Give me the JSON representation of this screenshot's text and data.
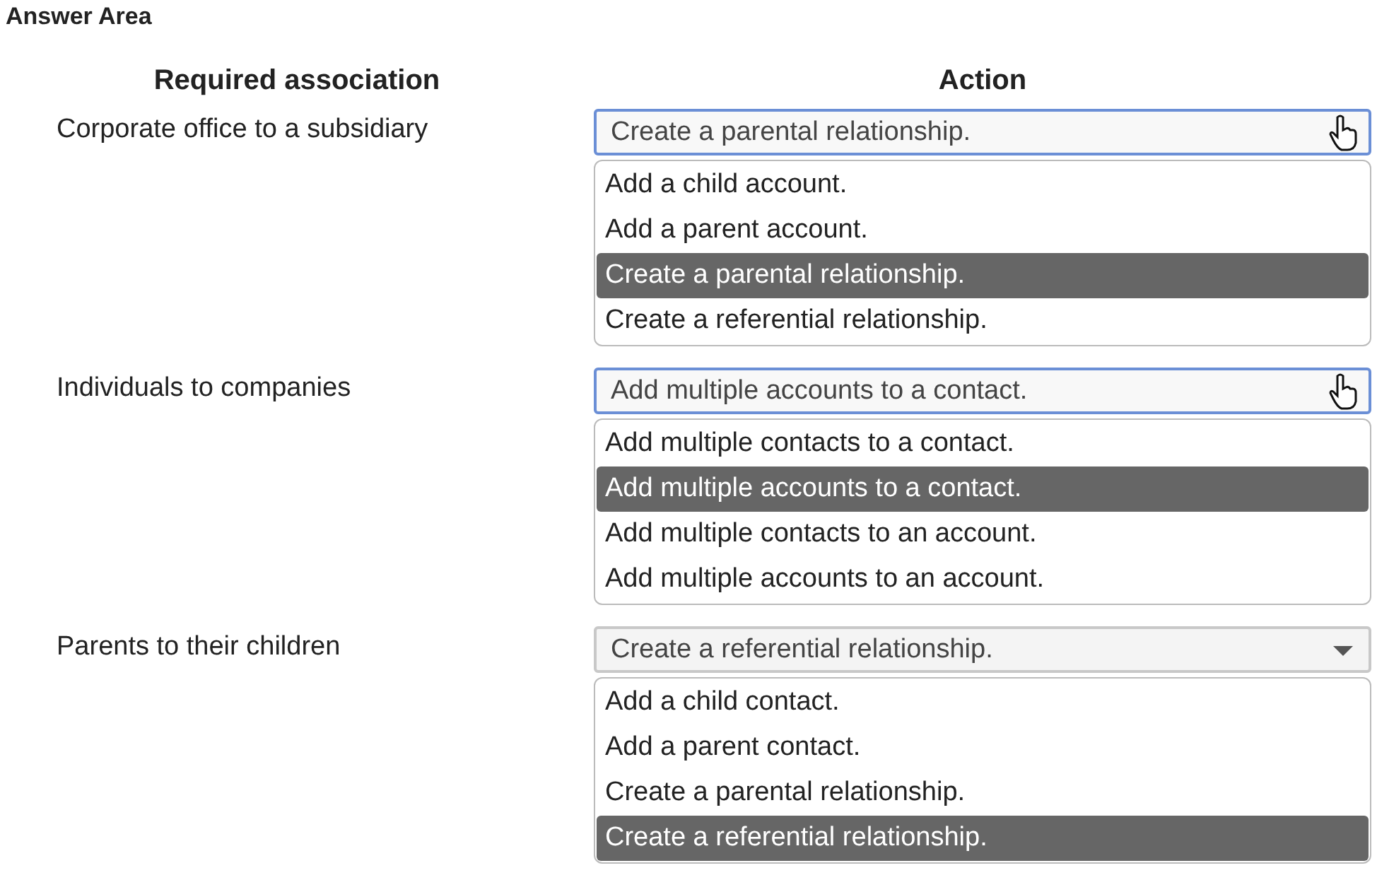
{
  "title": "Answer Area",
  "headers": [
    "Required association",
    "Action"
  ],
  "rows": [
    {
      "association": "Corporate office to a subsidiary",
      "dropdown": {
        "value": "Create a parental relationship.",
        "focused": true,
        "options": [
          {
            "label": "Add a child account.",
            "selected": false
          },
          {
            "label": "Add a parent account.",
            "selected": false
          },
          {
            "label": "Create a parental relationship.",
            "selected": true
          },
          {
            "label": "Create a referential relationship.",
            "selected": false
          }
        ]
      }
    },
    {
      "association": "Individuals to companies",
      "dropdown": {
        "value": "Add multiple accounts to a contact.",
        "focused": true,
        "options": [
          {
            "label": "Add multiple contacts to a contact.",
            "selected": false
          },
          {
            "label": "Add multiple accounts to a contact.",
            "selected": true
          },
          {
            "label": "Add multiple contacts to an account.",
            "selected": false
          },
          {
            "label": "Add multiple accounts to an account.",
            "selected": false
          }
        ]
      }
    },
    {
      "association": "Parents to their children",
      "dropdown": {
        "value": "Create a referential relationship.",
        "focused": false,
        "options": [
          {
            "label": "Add a child contact.",
            "selected": false
          },
          {
            "label": "Add a parent contact.",
            "selected": false
          },
          {
            "label": "Create a parental relationship.",
            "selected": false
          },
          {
            "label": "Create a referential relationship.",
            "selected": true
          }
        ]
      }
    }
  ]
}
